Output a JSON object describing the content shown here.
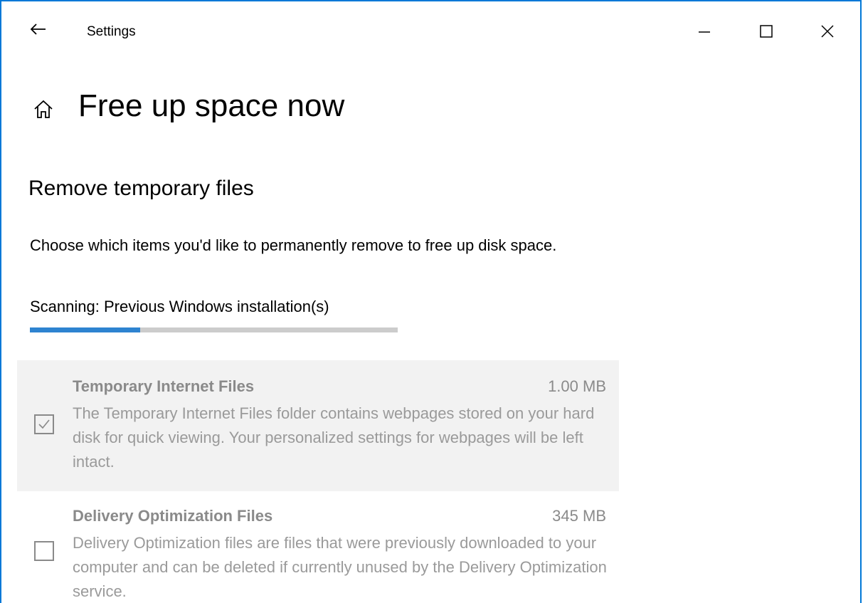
{
  "window": {
    "title": "Settings"
  },
  "header": {
    "title": "Free up space now"
  },
  "section": {
    "title": "Remove temporary files",
    "description": "Choose which items you'd like to permanently remove to free up disk space.",
    "scan_status": "Scanning: Previous Windows installation(s)",
    "progress_percent": 30
  },
  "items": [
    {
      "name": "Temporary Internet Files",
      "size": "1.00 MB",
      "description": "The Temporary Internet Files folder contains webpages stored on your hard disk for quick viewing. Your personalized settings for webpages will be left intact.",
      "checked": true
    },
    {
      "name": "Delivery Optimization Files",
      "size": "345 MB",
      "description": "Delivery Optimization files are files that were previously downloaded to your computer and can be deleted if currently unused by the Delivery Optimization service.",
      "checked": false
    }
  ],
  "colors": {
    "accent": "#0078d7",
    "progress_fill": "#2e83d0",
    "progress_track": "#cccccc",
    "item_highlight": "#f2f2f2",
    "disabled_text": "#8a8a8a"
  },
  "icons": {
    "back": "back-arrow-icon",
    "home": "home-icon",
    "minimize": "minimize-icon",
    "maximize": "maximize-icon",
    "close": "close-icon",
    "check": "checkmark-icon"
  }
}
